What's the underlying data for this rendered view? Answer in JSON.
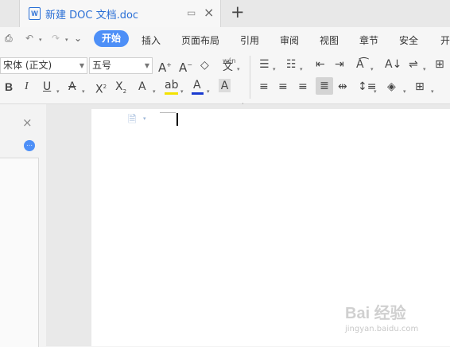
{
  "tab": {
    "title": "新建 DOC 文档.doc",
    "doc_icon": "W"
  },
  "menu": {
    "items": [
      "开始",
      "插入",
      "页面布局",
      "引用",
      "审阅",
      "视图",
      "章节",
      "安全",
      "开"
    ],
    "active": "开始"
  },
  "ribbon": {
    "font_name": "宋体 (正文)",
    "font_size": "五号",
    "pinyin_label": "wén",
    "accent_color": "#4d8ff7",
    "font_color_bar": "#1a3bd0",
    "highlight_color_bar": "#f3e200"
  },
  "watermark": {
    "brand": "Bai 经验",
    "url": "jingyan.baidu.com"
  }
}
